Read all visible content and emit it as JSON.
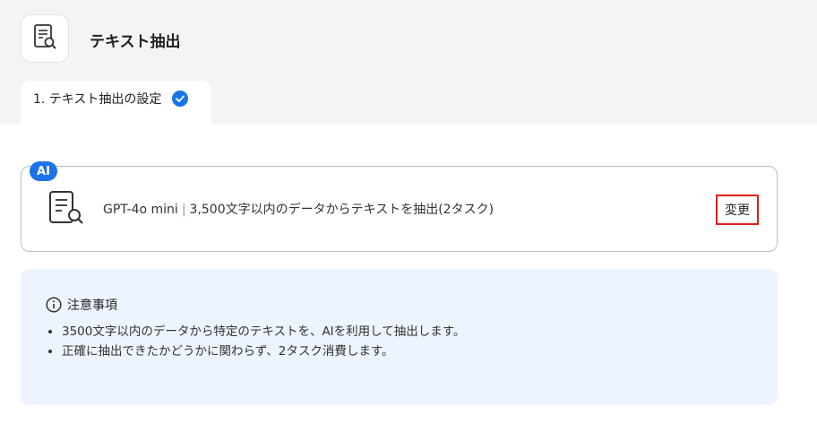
{
  "header": {
    "title": "テキスト抽出",
    "icon": "document-search-icon"
  },
  "step_tab": {
    "label": "1. テキスト抽出の設定",
    "status_icon": "check-circle-icon",
    "status_color": "#1a73e8"
  },
  "ai_card": {
    "badge": "AI",
    "icon": "document-search-icon",
    "model": "GPT-4o mini",
    "separator": "|",
    "description": "3,500文字以内のデータからテキストを抽出(2タスク)",
    "change_label": "変更"
  },
  "notice": {
    "title": "注意事項",
    "icon": "info-icon",
    "items": [
      "3500文字以内のデータから特定のテキストを、AIを利用して抽出します。",
      "正確に抽出できたかどうかに関わらず、2タスク消費します。"
    ]
  },
  "colors": {
    "accent": "#1a73e8",
    "highlight_border": "#e01e1e",
    "notice_bg": "#edf4fd"
  }
}
